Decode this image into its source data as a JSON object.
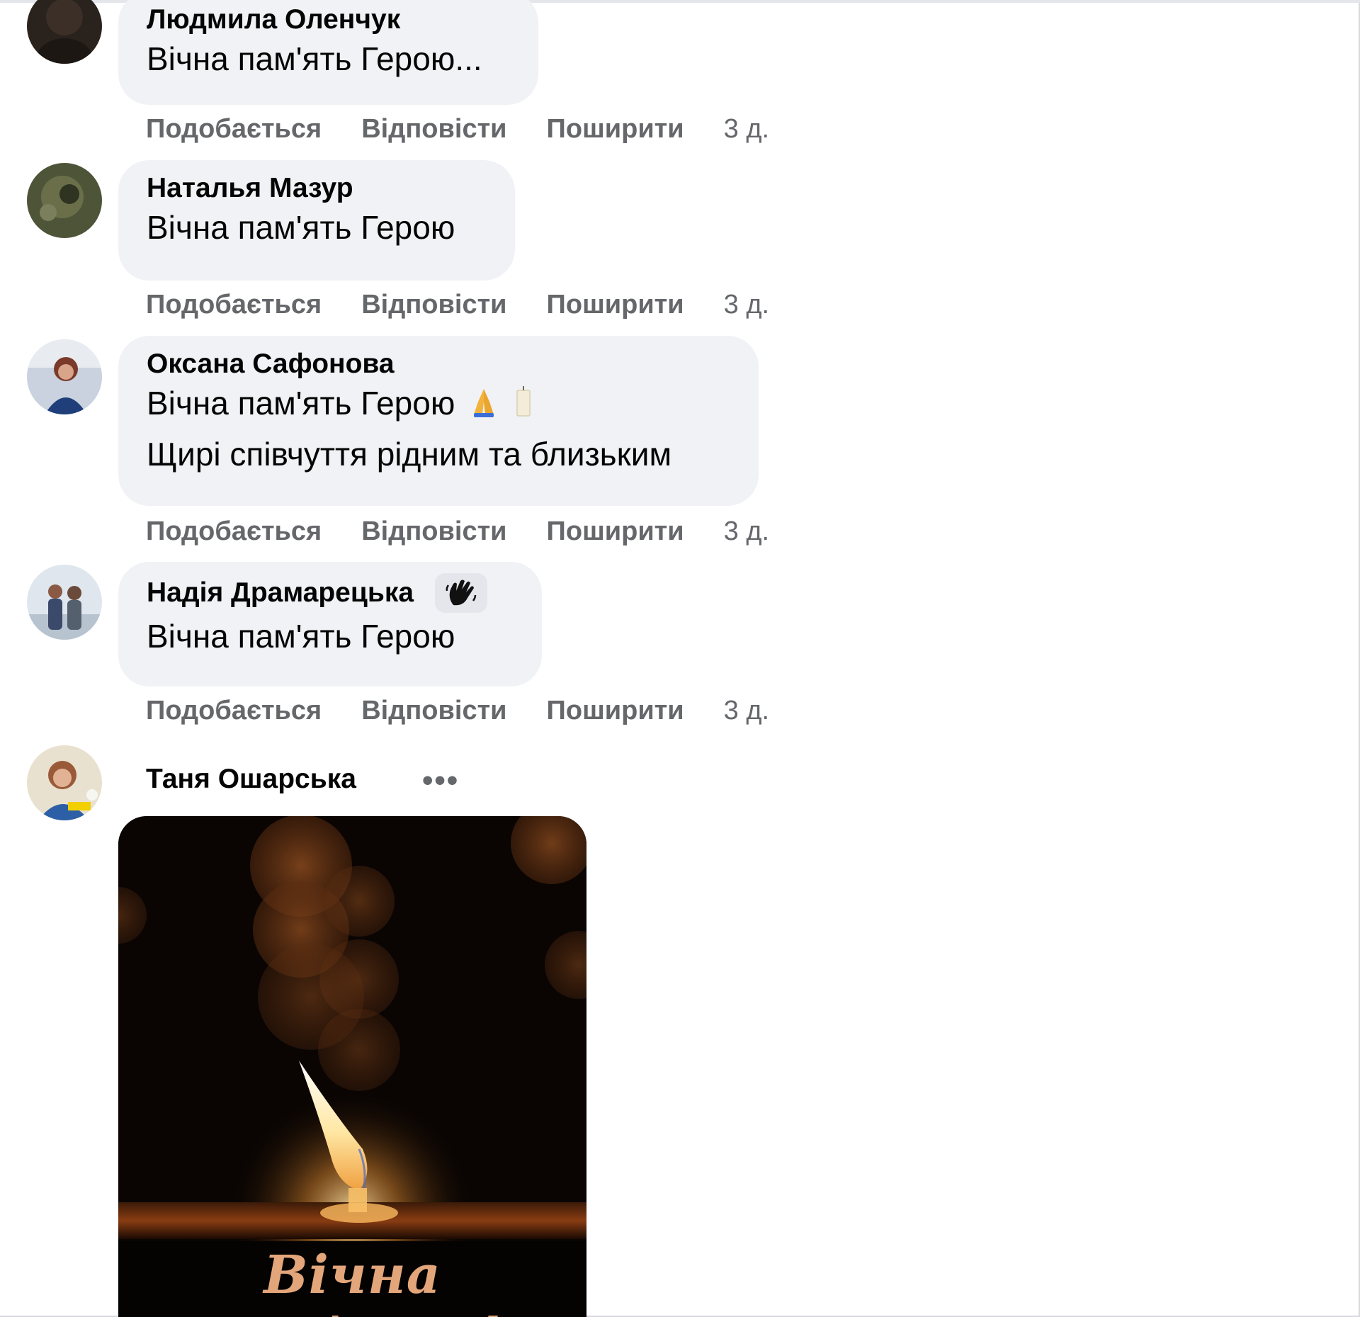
{
  "actions": {
    "like": "Подобається",
    "reply": "Відповісти",
    "share": "Поширити"
  },
  "comments": [
    {
      "author": "Людмила Оленчук",
      "text": "Вічна пам'ять Герою...",
      "time": "3 д."
    },
    {
      "author": "Наталья Мазур",
      "text": "Вічна пам'ять Герою",
      "time": "3 д."
    },
    {
      "author": "Оксана Сафонова",
      "text": "Вічна пам'ять Герою",
      "text2": "Щирі співчуття рідним та близьким",
      "emojis": [
        "folded-hands-emoji",
        "candle-emoji"
      ],
      "time": "3 д."
    },
    {
      "author": "Надія Драмарецька",
      "badge_icon": "waving-hand-icon",
      "text": "Вічна пам'ять Герою",
      "time": "3 д."
    },
    {
      "author": "Таня Ошарська",
      "more": "•••",
      "image_caption": "Вічна пам'ять!"
    }
  ],
  "colors": {
    "bubble": "#f0f2f5",
    "secondary_text": "#65676b",
    "caption": "#e3a67a"
  }
}
